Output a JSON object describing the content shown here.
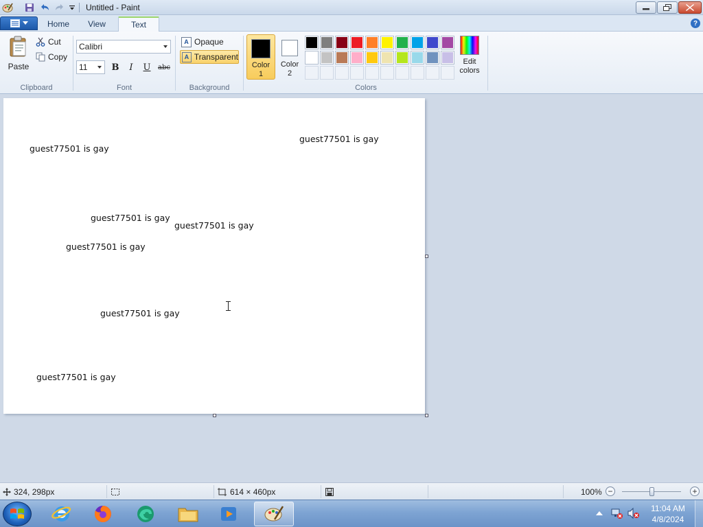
{
  "window": {
    "title": "Untitled - Paint"
  },
  "ribbon": {
    "tabs": [
      {
        "label": "Home",
        "active": false
      },
      {
        "label": "View",
        "active": false
      },
      {
        "label": "Text",
        "active": true
      }
    ],
    "clipboard": {
      "paste": "Paste",
      "cut": "Cut",
      "copy": "Copy",
      "label": "Clipboard"
    },
    "font": {
      "family": "Calibri",
      "size": "11",
      "bold": "B",
      "italic": "I",
      "underline": "U",
      "strike": "abc",
      "label": "Font"
    },
    "background": {
      "opaque": "Opaque",
      "transparent": "Transparent",
      "selected": "transparent",
      "label": "Background"
    },
    "colors": {
      "color1_label": "Color",
      "color1_num": "1",
      "color2_label": "Color",
      "color2_num": "2",
      "color1_value": "#000000",
      "color2_value": "#ffffff",
      "edit_label": "Edit",
      "edit_label2": "colors",
      "label": "Colors",
      "palette_row1": [
        "#000000",
        "#7f7f7f",
        "#880015",
        "#ed1c24",
        "#ff7f27",
        "#fff200",
        "#22b14c",
        "#00a2e8",
        "#3f48cc",
        "#a349a4"
      ],
      "palette_row2": [
        "#ffffff",
        "#c3c3c3",
        "#b97a57",
        "#ffaec9",
        "#ffc90e",
        "#efe4b0",
        "#b5e61d",
        "#99d9ea",
        "#7092be",
        "#c8bfe7"
      ]
    }
  },
  "canvas": {
    "texts": [
      "guest77501 is gay",
      "guest77501 is gay",
      "guest77501 is gay",
      "guest77501 is gay",
      "guest77501 is gay",
      "guest77501 is gay",
      "guest77501 is gay"
    ]
  },
  "status": {
    "cursor_pos": "324, 298px",
    "canvas_size": "614 × 460px",
    "zoom": "100%",
    "zoom_fraction": 0.5
  },
  "taskbar": {
    "time": "11:04 AM",
    "date": "4/8/2024"
  }
}
